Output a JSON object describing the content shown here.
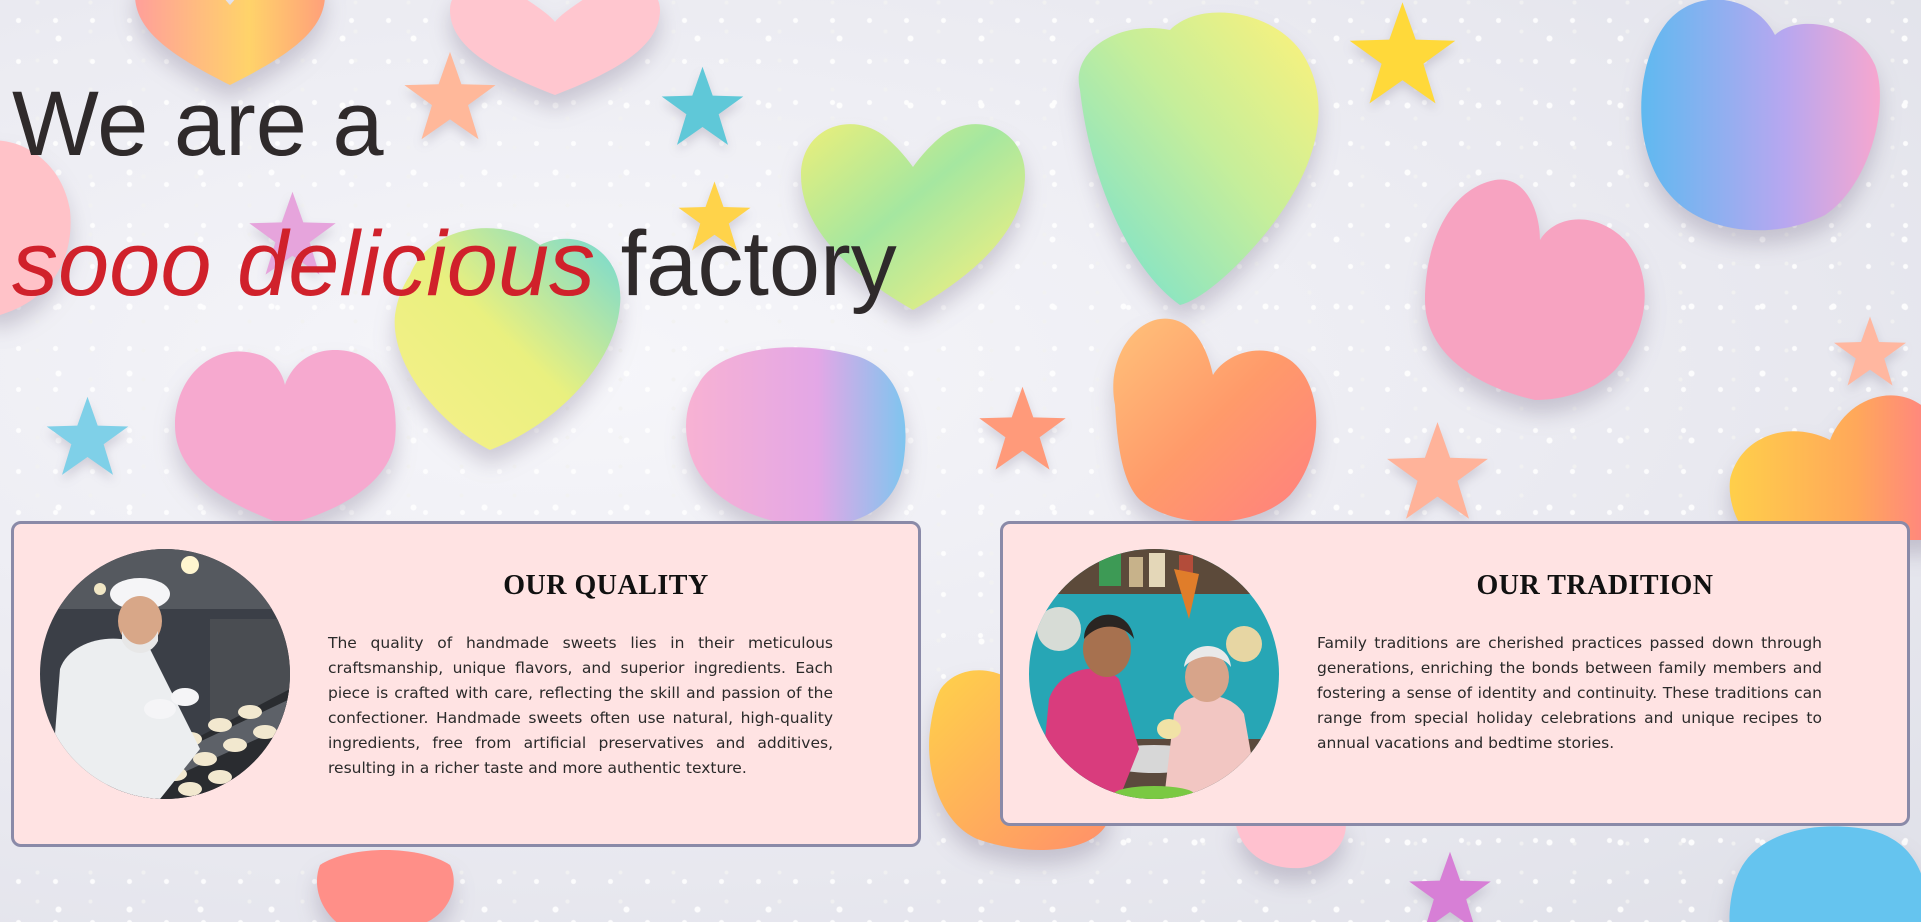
{
  "hero": {
    "line1": "We are a",
    "accent": "sooo delicious",
    "line2_rest": "factory"
  },
  "cards": [
    {
      "title": "OUR QUALITY",
      "image": "confectioner-photo",
      "text": "The quality of handmade sweets lies in their meticulous craftsmanship, unique flavors, and superior ingredients. Each piece is crafted with care, reflecting the skill and passion of the confectioner. Handmade sweets often use natural, high-quality ingredients, free from artificial preservatives and additives, resulting in a richer taste and more authentic texture."
    },
    {
      "title": "OUR TRADITION",
      "image": "grandmothers-cooking-photo",
      "text": "Family traditions are cherished practices passed down through generations, enriching the bonds between family members and fostering a sense of identity and continuity. These traditions can range from special holiday celebrations and unique recipes to annual vacations and bedtime stories."
    }
  ],
  "colors": {
    "accent": "#d0212b",
    "card_bg": "#ffe3e3",
    "card_border": "#8a8aa8",
    "text": "#2f2a2b"
  }
}
